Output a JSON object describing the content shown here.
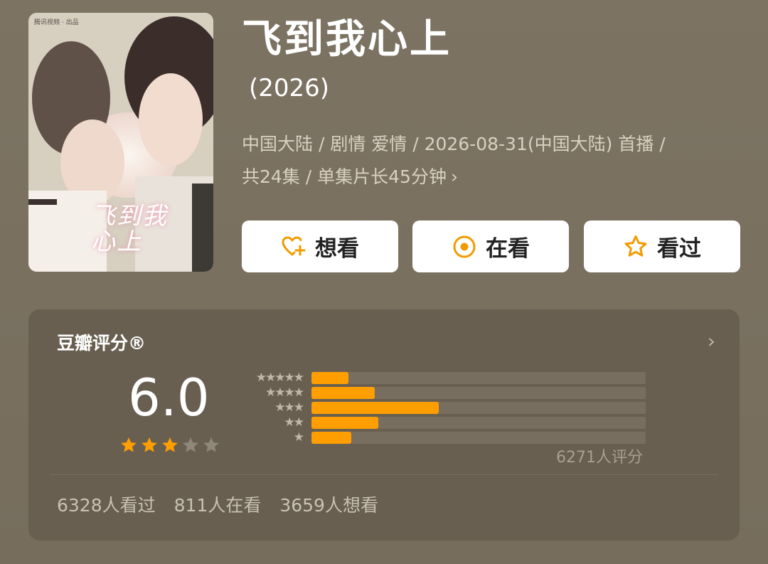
{
  "show": {
    "title": "飞到我心上",
    "year": "(2026)",
    "meta_line1": "中国大陆 / 剧情 爱情 / 2026-08-31(中国大陆) 首播 /",
    "meta_line2": "共24集 / 单集片长45分钟",
    "poster_title": "飞到我心上",
    "poster_logos": "腾讯视频 · 出品"
  },
  "actions": {
    "want": "想看",
    "watching": "在看",
    "watched": "看过"
  },
  "colors": {
    "accent": "#ff9e00",
    "background": "#7a7161",
    "card": "#685f51",
    "star_filled": "#ff9e00",
    "star_empty": "#8f877a"
  },
  "rating": {
    "title": "豆瓣评分®",
    "score": "6.0",
    "stars": 3,
    "stars_max": 5,
    "raters": "6271人评分",
    "distribution": [
      {
        "stars": 5,
        "label": "★★★★★",
        "fraction": 0.11
      },
      {
        "stars": 4,
        "label": "★★★★",
        "fraction": 0.19
      },
      {
        "stars": 3,
        "label": "★★★",
        "fraction": 0.38
      },
      {
        "stars": 2,
        "label": "★★",
        "fraction": 0.2
      },
      {
        "stars": 1,
        "label": "★",
        "fraction": 0.12
      }
    ]
  },
  "counts": {
    "watched": "6328人看过",
    "watching": "811人在看",
    "want": "3659人想看"
  },
  "icons": {
    "want": "heart-plus-icon",
    "watching": "circle-dot-icon",
    "watched": "star-outline-icon",
    "more": "chevron-right-icon"
  }
}
